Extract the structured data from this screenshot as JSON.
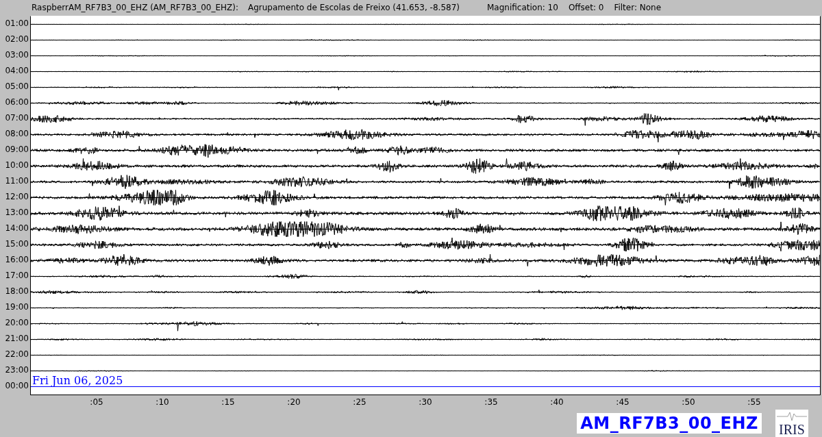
{
  "header": {
    "station": "RaspberrAM_RF7B3_00_EHZ (AM_RF7B3_00_EHZ):",
    "location": "Agrupamento de Escolas de Freixo (41.653, -8.587)",
    "magnification": "Magnification: 10",
    "offset": "Offset: 0",
    "filter": "Filter: None"
  },
  "rows": [
    {
      "label": "01:00",
      "color": "#000000"
    },
    {
      "label": "02:00",
      "color": "#000000"
    },
    {
      "label": "03:00",
      "color": "#000000"
    },
    {
      "label": "04:00",
      "color": "#000000"
    },
    {
      "label": "05:00",
      "color": "#000000"
    },
    {
      "label": "06:00",
      "color": "#000000"
    },
    {
      "label": "07:00",
      "color": "#000000"
    },
    {
      "label": "08:00",
      "color": "#000000"
    },
    {
      "label": "09:00",
      "color": "#000000"
    },
    {
      "label": "10:00",
      "color": "#000000"
    },
    {
      "label": "11:00",
      "color": "#000000"
    },
    {
      "label": "12:00",
      "color": "#000000"
    },
    {
      "label": "13:00",
      "color": "#000000"
    },
    {
      "label": "14:00",
      "color": "#000000"
    },
    {
      "label": "15:00",
      "color": "#000000"
    },
    {
      "label": "16:00",
      "color": "#000000"
    },
    {
      "label": "17:00",
      "color": "#000000"
    },
    {
      "label": "18:00",
      "color": "#000000"
    },
    {
      "label": "19:00",
      "color": "#000000"
    },
    {
      "label": "20:00",
      "color": "#000000"
    },
    {
      "label": "21:00",
      "color": "#000000"
    },
    {
      "label": "22:00",
      "color": "#000000"
    },
    {
      "label": "23:00",
      "color": "#000000"
    },
    {
      "label": "00:00",
      "color": "#0000ff"
    }
  ],
  "date": "Fri Jun 06, 2025",
  "x_ticks": [
    ":05",
    ":10",
    ":15",
    ":20",
    ":25",
    ":30",
    ":35",
    ":40",
    ":45",
    ":50",
    ":55"
  ],
  "channel_label": "AM_RF7B3_00_EHZ",
  "logo": "IRIS"
}
